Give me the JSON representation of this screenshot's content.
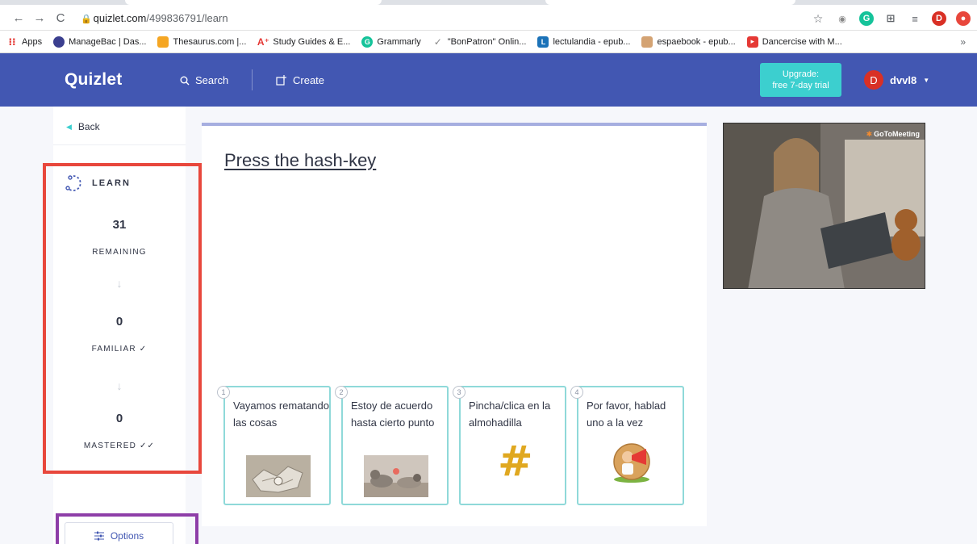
{
  "browser": {
    "url_host": "quizlet.com",
    "url_path": "/499836791/learn",
    "avatar_letter": "D"
  },
  "bookmarks": [
    {
      "label": "Apps",
      "icon": "apps-grid-icon",
      "color": "#e53935"
    },
    {
      "label": "ManageBac | Das...",
      "icon": "managebac-icon",
      "color": "#3b3f8f"
    },
    {
      "label": "Thesaurus.com |...",
      "icon": "thesaurus-icon",
      "color": "#f5a623"
    },
    {
      "label": "Study Guides & E...",
      "icon": "study-guides-icon",
      "color": "#e53935"
    },
    {
      "label": "Grammarly",
      "icon": "grammarly-icon",
      "color": "#15c39a"
    },
    {
      "label": "\"BonPatron\" Onlin...",
      "icon": "bonpatron-icon",
      "color": "#888888"
    },
    {
      "label": "lectulandia - epub...",
      "icon": "lectulandia-icon",
      "color": "#1b72b8"
    },
    {
      "label": "espaebook - epub...",
      "icon": "espaebook-icon",
      "color": "#d4a373"
    },
    {
      "label": "Dancercise with M...",
      "icon": "youtube-icon",
      "color": "#e53935"
    }
  ],
  "header": {
    "logo": "Quizlet",
    "search_label": "Search",
    "create_label": "Create",
    "upgrade_line1": "Upgrade:",
    "upgrade_line2": "free 7-day trial",
    "user_initial": "D",
    "username": "dvvl8"
  },
  "sidebar": {
    "back_label": "Back",
    "mode_label": "LEARN",
    "remaining_count": "31",
    "remaining_label": "REMAINING",
    "familiar_count": "0",
    "familiar_label": "FAMILIAR ✓",
    "mastered_count": "0",
    "mastered_label": "MASTERED ✓✓",
    "options_label": "Options"
  },
  "question": {
    "prompt": "Press the hash-key"
  },
  "choices": [
    {
      "num": "1",
      "text": "Vayamos rematando las cosas",
      "image": "crumpled-paper-image"
    },
    {
      "num": "2",
      "text": "Estoy de acuerdo hasta cierto punto",
      "image": "animals-image"
    },
    {
      "num": "3",
      "text": "Pincha/clica en la almohadilla",
      "image": "hash-symbol-image",
      "glyph": "#"
    },
    {
      "num": "4",
      "text": "Por favor, hablad uno a la vez",
      "image": "megaphone-man-image"
    }
  ],
  "ad": {
    "brand": "GoToMeeting"
  },
  "colors": {
    "header_bg": "#4257b2",
    "accent_teal": "#3ccfcf",
    "learn_box_border": "#e8473c",
    "options_box_border": "#8e3ea8"
  }
}
